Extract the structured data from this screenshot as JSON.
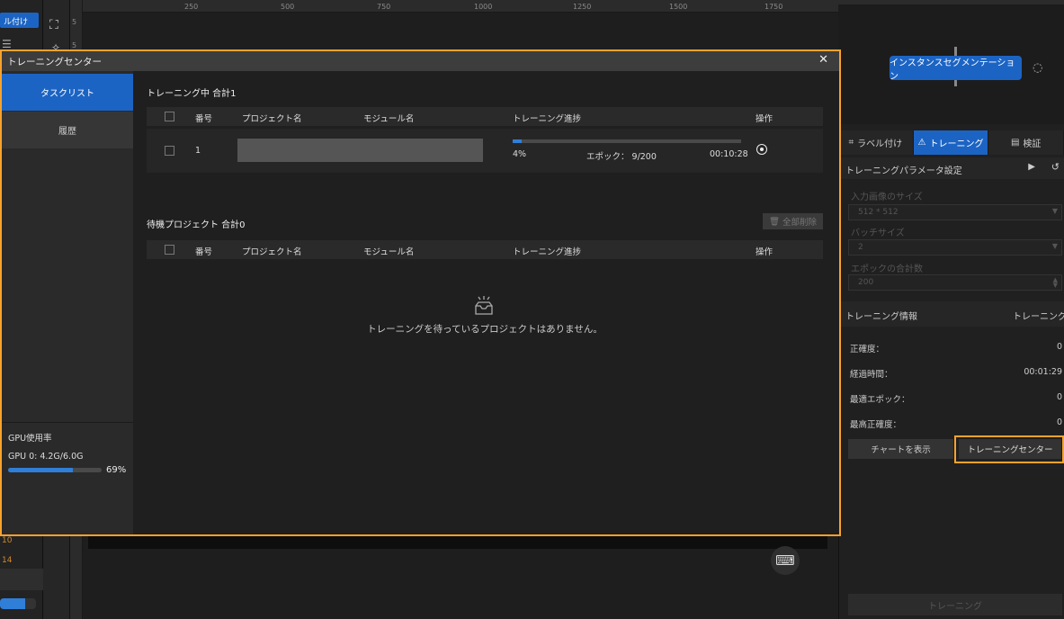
{
  "background": {
    "label_chip": "ル付け",
    "ruler_ticks": [
      "250",
      "500",
      "750",
      "1000",
      "1250",
      "1500",
      "1750"
    ],
    "vruler_ticks": [
      "5",
      "5"
    ],
    "left_numbers": [
      "10",
      "14"
    ]
  },
  "right_panel": {
    "node_button": "インスタンスセグメンテーション",
    "tabs": [
      {
        "label": "ラベル付け",
        "icon": "crop-icon"
      },
      {
        "label": "トレーニング",
        "icon": "train-icon",
        "active": true
      },
      {
        "label": "検証",
        "icon": "doc-icon"
      }
    ],
    "param_header": "トレーニングパラメータ設定",
    "params": [
      {
        "label": "入力画像のサイズ",
        "value": "512 * 512"
      },
      {
        "label": "バッチサイズ",
        "value": "2"
      },
      {
        "label": "エポックの合計数",
        "value": "200"
      }
    ],
    "info_header": "トレーニング情報",
    "info_header_right": "トレーニング中",
    "info": [
      {
        "label": "正確度：",
        "value": "0"
      },
      {
        "label": "経過時間：",
        "value": "00:01:29"
      },
      {
        "label": "最適エポック：",
        "value": "0"
      },
      {
        "label": "最高正確度：",
        "value": "0"
      }
    ],
    "chart_button": "チャートを表示",
    "center_button": "トレーニングセンター",
    "train_button": "トレーニング"
  },
  "dialog": {
    "title": "トレーニングセンター",
    "sidebar": {
      "task_list": "タスクリスト",
      "history": "履歴"
    },
    "gpu": {
      "title": "GPU使用率",
      "line": "GPU 0: 4.2G/6.0G",
      "percent_label": "69%",
      "percent": 69
    },
    "training_section": {
      "title": "トレーニング中  合計1",
      "columns": [
        "番号",
        "プロジェクト名",
        "モジュール名",
        "トレーニング進捗",
        "操作"
      ],
      "rows": [
        {
          "number": "1",
          "progress_pct": 4,
          "progress_label": "4%",
          "epoch": "エポック：  9/200",
          "time": "00:10:28"
        }
      ]
    },
    "waiting_section": {
      "title": "待機プロジェクト  合計0",
      "delete_all": "全部削除",
      "columns": [
        "番号",
        "プロジェクト名",
        "モジュール名",
        "トレーニング進捗",
        "操作"
      ],
      "empty_text": "トレーニングを待っているプロジェクトはありません。"
    }
  }
}
